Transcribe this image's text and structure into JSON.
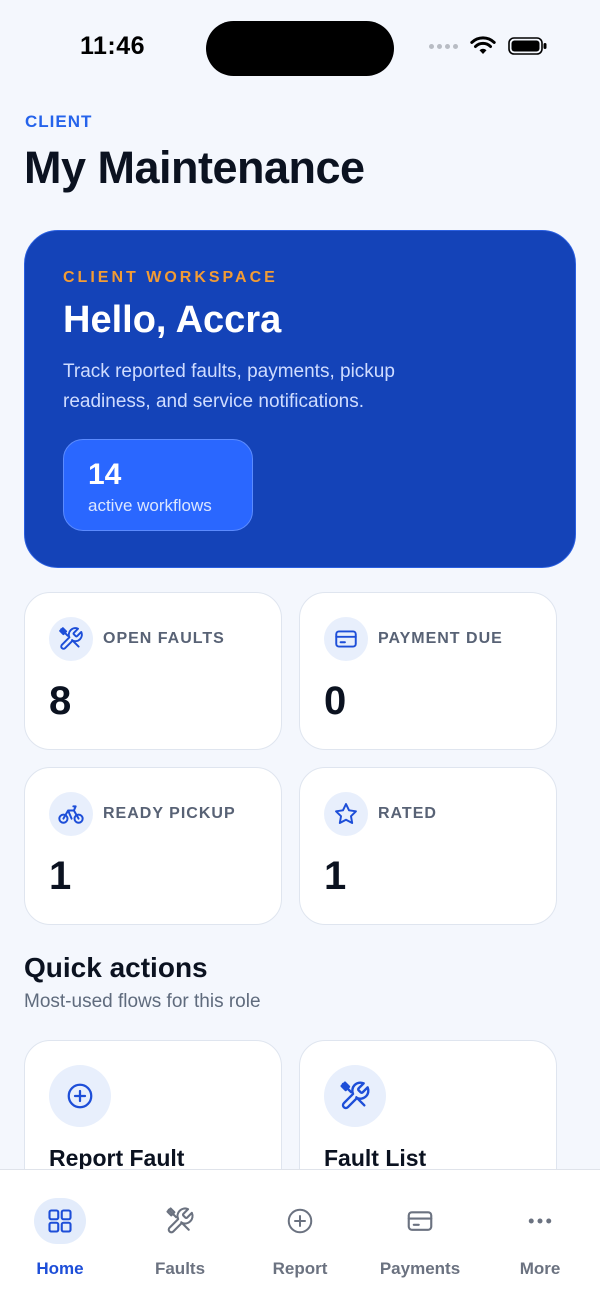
{
  "status": {
    "time": "11:46"
  },
  "header": {
    "role": "CLIENT",
    "title": "My Maintenance"
  },
  "hero": {
    "eyebrow": "CLIENT WORKSPACE",
    "greeting": "Hello, Accra",
    "description": "Track reported faults, payments, pickup readiness, and service notifications.",
    "stat_value": "14",
    "stat_label": "active workflows"
  },
  "stats": [
    {
      "label": "OPEN FAULTS",
      "value": "8",
      "icon": "tools-icon"
    },
    {
      "label": "PAYMENT DUE",
      "value": "0",
      "icon": "credit-card-icon"
    },
    {
      "label": "READY PICKUP",
      "value": "1",
      "icon": "bicycle-icon"
    },
    {
      "label": "RATED",
      "value": "1",
      "icon": "star-icon"
    }
  ],
  "quick_actions": {
    "title": "Quick actions",
    "subtitle": "Most-used flows for this role",
    "items": [
      {
        "label": "Report Fault",
        "icon": "plus-circle-icon"
      },
      {
        "label": "Fault List",
        "icon": "tools-icon"
      }
    ]
  },
  "tabs": [
    {
      "label": "Home",
      "icon": "grid-icon",
      "active": true
    },
    {
      "label": "Faults",
      "icon": "tools-icon",
      "active": false
    },
    {
      "label": "Report",
      "icon": "plus-circle-icon",
      "active": false
    },
    {
      "label": "Payments",
      "icon": "credit-card-icon",
      "active": false
    },
    {
      "label": "More",
      "icon": "more-dots-icon",
      "active": false
    }
  ],
  "colors": {
    "accent": "#2563eb",
    "hero_bg": "#1443b8",
    "eyebrow": "#f39c34"
  }
}
